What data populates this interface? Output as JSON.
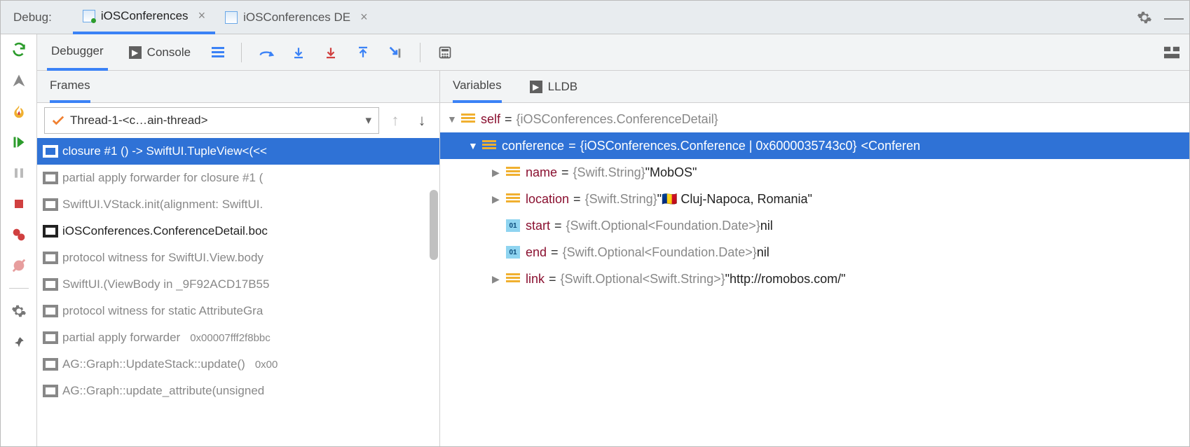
{
  "header": {
    "title": "Debug:",
    "tabs": [
      {
        "label": "iOSConferences",
        "active": true
      },
      {
        "label": "iOSConferences DE",
        "active": false
      }
    ]
  },
  "toolbar": {
    "tabs": {
      "debugger": "Debugger",
      "console": "Console"
    }
  },
  "frames": {
    "title": "Frames",
    "thread": "Thread-1-<c…ain-thread>",
    "items": [
      {
        "text": "closure #1 () -> SwiftUI.TupleView<(<<",
        "selected": true,
        "muted": false
      },
      {
        "text": "partial apply forwarder for closure #1 (",
        "muted": true
      },
      {
        "text": "SwiftUI.VStack.init(alignment: SwiftUI.",
        "muted": true
      },
      {
        "text": "iOSConferences.ConferenceDetail.boc",
        "muted": false
      },
      {
        "text": "protocol witness for SwiftUI.View.body",
        "muted": true
      },
      {
        "text": "SwiftUI.(ViewBody in _9F92ACD17B55",
        "muted": true
      },
      {
        "text": "protocol witness for static AttributeGra",
        "muted": true
      },
      {
        "text": "partial apply forwarder",
        "addr": "0x00007fff2f8bbc",
        "muted": true
      },
      {
        "text": "AG::Graph::UpdateStack::update()",
        "addr": "0x00",
        "muted": true
      },
      {
        "text": "AG::Graph::update_attribute(unsigned",
        "muted": true
      }
    ]
  },
  "variables": {
    "title": "Variables",
    "lldb": "LLDB",
    "tree": {
      "self": {
        "name": "self",
        "type": "{iOSConferences.ConferenceDetail}"
      },
      "conference": {
        "name": "conference",
        "type": "{iOSConferences.Conference | 0x6000035743c0}",
        "suffix": "<Conferen"
      },
      "fields": [
        {
          "name": "name",
          "type": "{Swift.String}",
          "value": "\"MobOS\"",
          "kind": "obj",
          "exp": true
        },
        {
          "name": "location",
          "type": "{Swift.String}",
          "value": "\"🇷🇴 Cluj-Napoca, Romania\"",
          "kind": "obj",
          "exp": true
        },
        {
          "name": "start",
          "type": "{Swift.Optional<Foundation.Date>}",
          "value": "nil",
          "kind": "num",
          "exp": false
        },
        {
          "name": "end",
          "type": "{Swift.Optional<Foundation.Date>}",
          "value": "nil",
          "kind": "num",
          "exp": false
        },
        {
          "name": "link",
          "type": "{Swift.Optional<Swift.String>}",
          "value": "\"http://romobos.com/\"",
          "kind": "obj",
          "exp": true
        }
      ]
    }
  }
}
